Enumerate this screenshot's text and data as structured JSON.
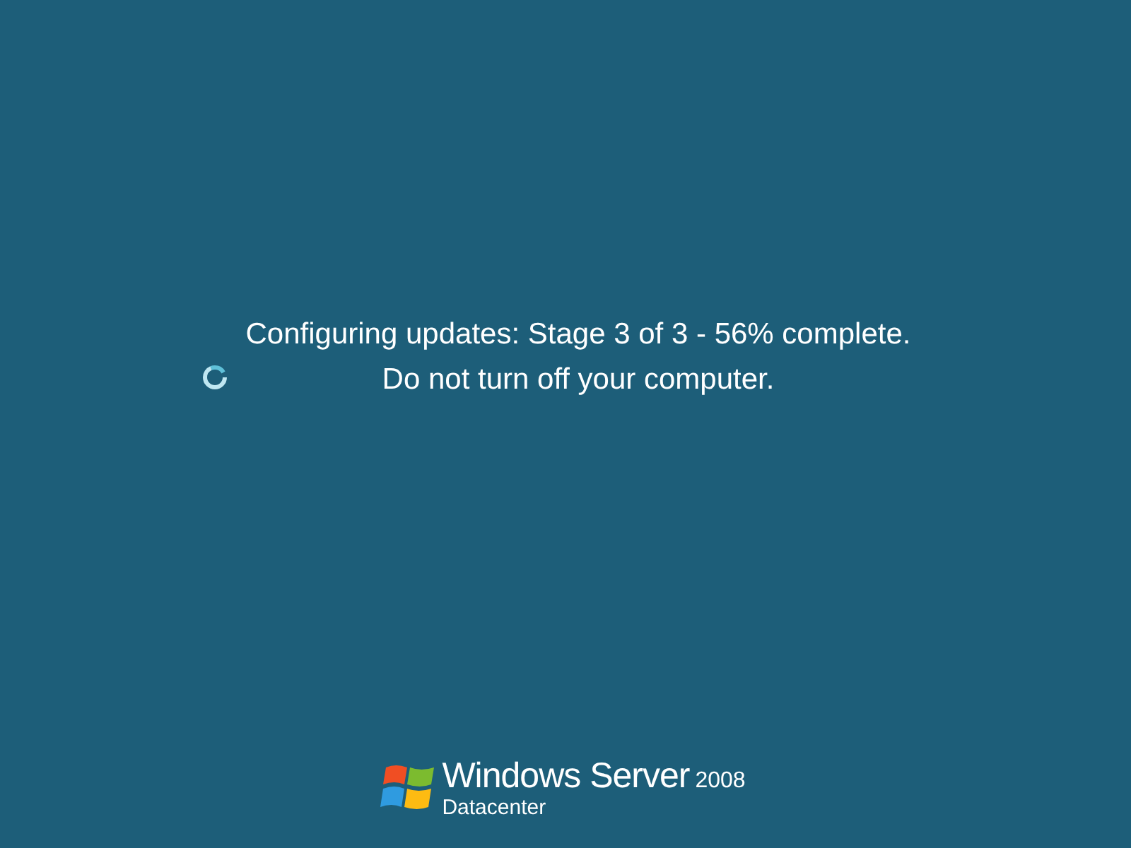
{
  "status": {
    "lines": [
      "Configuring updates: Stage 3 of 3 - 56% complete.",
      "Do not turn off your computer."
    ]
  },
  "logo": {
    "product": "Windows Server",
    "version": "2008",
    "edition": "Datacenter"
  }
}
